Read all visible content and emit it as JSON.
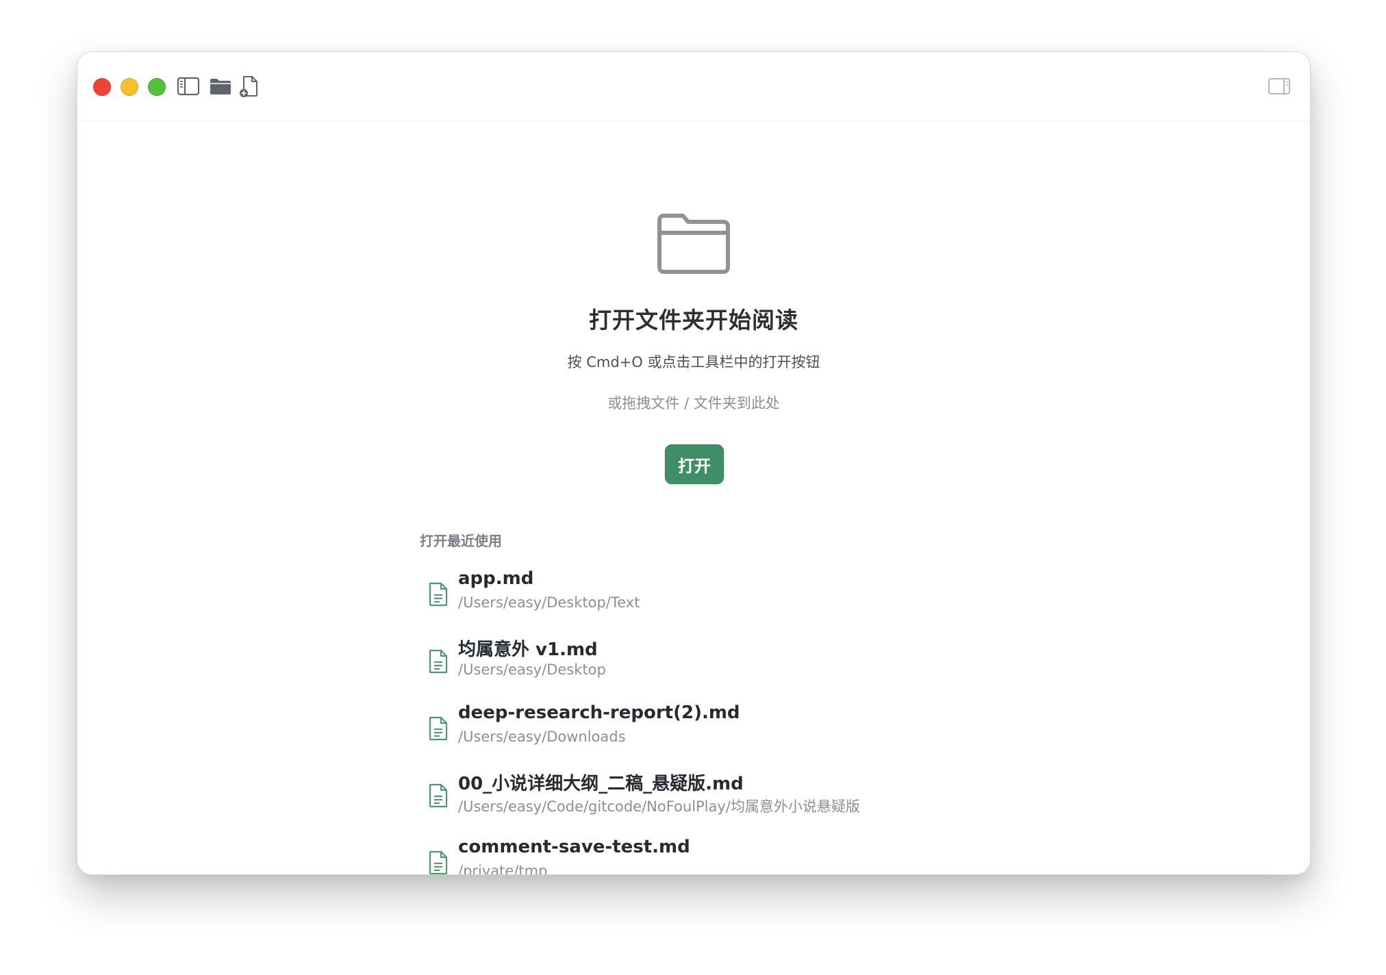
{
  "toolbar": {
    "icons": [
      "sidebar-toggle-icon",
      "open-folder-icon",
      "new-file-icon",
      "right-panel-toggle-icon"
    ]
  },
  "hero": {
    "icon": "folder-icon",
    "title": "打开文件夹开始阅读",
    "subtitle": "按 Cmd+O 或点击工具栏中的打开按钮",
    "hint": "或拖拽文件 / 文件夹到此处",
    "open_label": "打开"
  },
  "recent": {
    "title": "打开最近使用",
    "items": [
      {
        "name": "app.md",
        "path": "/Users/easy/Desktop/Text"
      },
      {
        "name": "均属意外 v1.md",
        "path": "/Users/easy/Desktop"
      },
      {
        "name": "deep-research-report(2).md",
        "path": "/Users/easy/Downloads"
      },
      {
        "name": "00_小说详细大纲_二稿_悬疑版.md",
        "path": "/Users/easy/Code/gitcode/NoFoulPlay/均属意外小说悬疑版"
      },
      {
        "name": "comment-save-test.md",
        "path": "/private/tmp"
      }
    ]
  },
  "colors": {
    "accent": "#3f8f66",
    "file_icon": "#4a9a6e",
    "close": "#ee4437",
    "minimize": "#f5c02c",
    "maximize": "#52c23c"
  }
}
